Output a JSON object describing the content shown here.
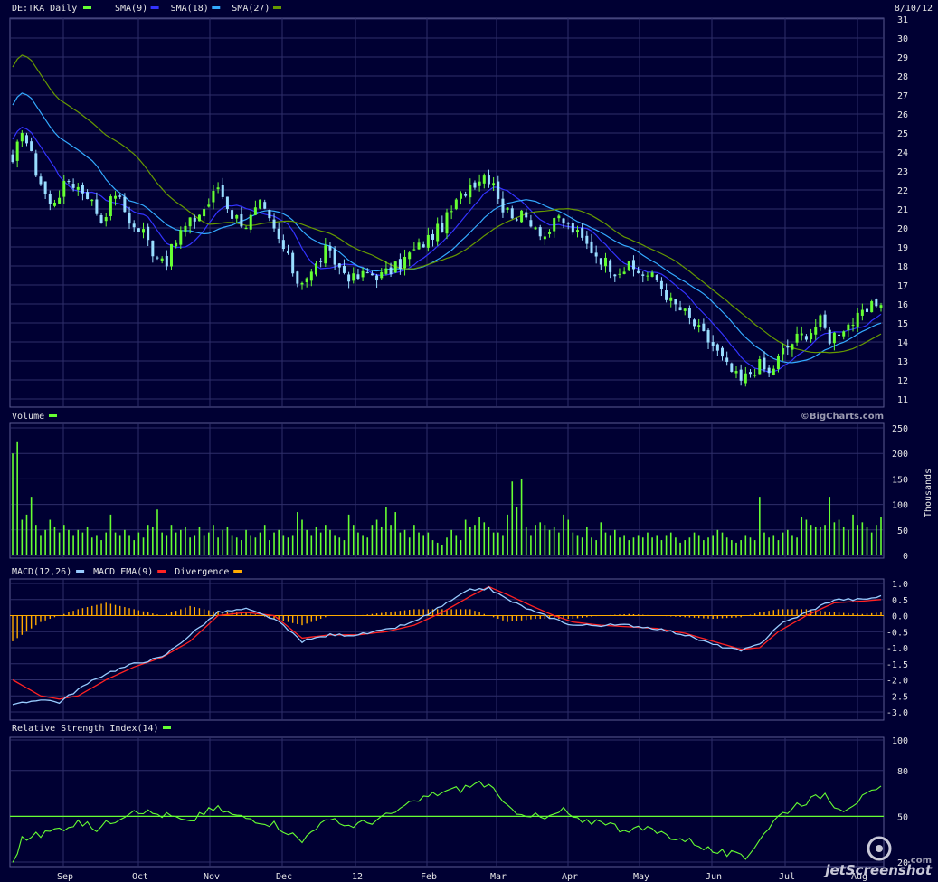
{
  "header": {
    "ticker_label": "DE:TKA Daily",
    "date": "8/10/12"
  },
  "legend_main": [
    {
      "label": "SMA(9)",
      "color": "#3333ff"
    },
    {
      "label": "SMA(18)",
      "color": "#33aaff"
    },
    {
      "label": "SMA(27)",
      "color": "#669900"
    }
  ],
  "ticker_color": "#66ff33",
  "volume_label": "Volume",
  "volume_unit": "Thousands",
  "watermark": "©BigCharts.com",
  "macd_legend": [
    {
      "label": "MACD(12,26)",
      "color": "#99ccff"
    },
    {
      "label": "MACD EMA(9)",
      "color": "#ff2222"
    },
    {
      "label": "Divergence",
      "color": "#ffaa00"
    }
  ],
  "rsi_label": "Relative Strength Index(14)",
  "rsi_color": "#66ff33",
  "logo_text": "jetScreenshot",
  "logo_sub": ".com",
  "x_months": [
    "Sep",
    "Oct",
    "Nov",
    "Dec",
    "12",
    "Feb",
    "Mar",
    "Apr",
    "May",
    "Jun",
    "Jul",
    "Aug"
  ],
  "chart_data": [
    {
      "type": "candlestick",
      "title": "DE:TKA Daily",
      "y_ticks": [
        "31",
        "30",
        "29",
        "28",
        "27",
        "26",
        "25",
        "24",
        "23",
        "22",
        "21",
        "20",
        "19",
        "18",
        "17",
        "16",
        "15",
        "14",
        "13",
        "12",
        "11"
      ],
      "ylim": [
        11,
        31
      ],
      "price_path": [
        [
          0,
          23.2
        ],
        [
          2,
          25.3
        ],
        [
          5,
          23
        ],
        [
          8,
          21.2
        ],
        [
          12,
          22.5
        ],
        [
          16,
          21.8
        ],
        [
          19,
          20.4
        ],
        [
          22,
          21.9
        ],
        [
          24,
          20.9
        ],
        [
          26,
          20
        ],
        [
          28,
          19.8
        ],
        [
          30,
          18.8
        ],
        [
          33,
          18.3
        ],
        [
          36,
          19.8
        ],
        [
          39,
          20.5
        ],
        [
          42,
          21.3
        ],
        [
          44,
          22.2
        ],
        [
          47,
          20.7
        ],
        [
          50,
          20.2
        ],
        [
          53,
          21.2
        ],
        [
          55,
          20.3
        ],
        [
          58,
          18.9
        ],
        [
          61,
          17.2
        ],
        [
          64,
          17.6
        ],
        [
          67,
          18.8
        ],
        [
          70,
          17.9
        ],
        [
          73,
          17.3
        ],
        [
          76,
          17.6
        ],
        [
          79,
          17.5
        ],
        [
          82,
          17.9
        ],
        [
          85,
          18.6
        ],
        [
          88,
          19.2
        ],
        [
          92,
          20.1
        ],
        [
          95,
          21.3
        ],
        [
          98,
          22.3
        ],
        [
          101,
          22.8
        ],
        [
          103,
          22.5
        ],
        [
          105,
          21
        ],
        [
          108,
          20.7
        ],
        [
          111,
          20.4
        ],
        [
          114,
          19.6
        ],
        [
          117,
          20.5
        ],
        [
          120,
          19.9
        ],
        [
          123,
          19.1
        ],
        [
          126,
          18.4
        ],
        [
          129,
          17.8
        ],
        [
          132,
          17.9
        ],
        [
          135,
          17.6
        ],
        [
          138,
          17.3
        ],
        [
          141,
          16.1
        ],
        [
          144,
          15.5
        ],
        [
          147,
          14.6
        ],
        [
          150,
          13.8
        ],
        [
          153,
          12.7
        ],
        [
          156,
          11.9
        ],
        [
          158,
          12.4
        ],
        [
          160,
          12.8
        ],
        [
          162,
          12.3
        ],
        [
          165,
          13.5
        ],
        [
          168,
          14.2
        ],
        [
          171,
          14.6
        ],
        [
          173,
          15.1
        ],
        [
          175,
          14.2
        ],
        [
          178,
          14.8
        ],
        [
          181,
          15.2
        ],
        [
          184,
          15.8
        ],
        [
          186,
          16.2
        ]
      ],
      "sessions": 187
    },
    {
      "type": "bar",
      "title": "Volume",
      "ylabel": "Thousands",
      "y_ticks": [
        "250",
        "200",
        "150",
        "100",
        "50",
        "0"
      ],
      "ylim": [
        0,
        250
      ],
      "values": [
        200,
        222,
        70,
        80,
        115,
        60,
        40,
        50,
        70,
        55,
        45,
        60,
        50,
        40,
        50,
        45,
        55,
        35,
        40,
        30,
        45,
        80,
        45,
        40,
        50,
        40,
        30,
        45,
        35,
        60,
        55,
        90,
        45,
        40,
        60,
        45,
        50,
        55,
        35,
        40,
        55,
        40,
        45,
        60,
        35,
        50,
        55,
        40,
        35,
        30,
        50,
        40,
        35,
        45,
        60,
        30,
        45,
        50,
        40,
        35,
        40,
        85,
        70,
        50,
        40,
        55,
        45,
        60,
        50,
        40,
        35,
        30,
        80,
        60,
        45,
        40,
        35,
        60,
        70,
        55,
        95,
        60,
        85,
        45,
        50,
        35,
        60,
        45,
        40,
        45,
        30,
        25,
        20,
        35,
        50,
        40,
        30,
        70,
        55,
        60,
        75,
        65,
        55,
        45,
        45,
        40,
        80,
        145,
        95,
        150,
        55,
        40,
        60,
        65,
        60,
        50,
        55,
        45,
        80,
        70,
        45,
        40,
        35,
        55,
        35,
        30,
        65,
        45,
        40,
        50,
        35,
        40,
        30,
        35,
        40,
        35,
        45,
        35,
        40,
        30,
        40,
        45,
        35,
        25,
        30,
        35,
        45,
        40,
        30,
        35,
        40,
        50,
        45,
        35,
        30,
        25,
        30,
        40,
        35,
        30,
        115,
        45,
        35,
        40,
        30,
        45,
        50,
        40,
        35,
        75,
        70,
        60,
        55,
        55,
        60,
        115,
        65,
        70,
        55,
        50,
        80,
        60,
        65,
        55,
        45,
        60,
        75,
        50,
        40,
        110,
        40,
        35,
        45,
        60
      ]
    },
    {
      "type": "line",
      "title": "MACD(12,26)",
      "y_ticks": [
        "1.0",
        "0.5",
        "0.0",
        "-0.5",
        "-1.0",
        "-1.5",
        "-2.0",
        "-2.5",
        "-3.0"
      ],
      "ylim": [
        -3.0,
        1.0
      ],
      "series": [
        {
          "name": "MACD(12,26)",
          "path": [
            [
              0,
              -2.8
            ],
            [
              6,
              -2.6
            ],
            [
              10,
              -2.7
            ],
            [
              14,
              -2.3
            ],
            [
              20,
              -1.8
            ],
            [
              26,
              -1.5
            ],
            [
              32,
              -1.3
            ],
            [
              38,
              -0.6
            ],
            [
              44,
              0.1
            ],
            [
              50,
              0.2
            ],
            [
              56,
              -0.1
            ],
            [
              62,
              -0.8
            ],
            [
              68,
              -0.6
            ],
            [
              74,
              -0.6
            ],
            [
              80,
              -0.45
            ],
            [
              86,
              -0.2
            ],
            [
              92,
              0.3
            ],
            [
              98,
              0.8
            ],
            [
              102,
              0.85
            ],
            [
              106,
              0.5
            ],
            [
              112,
              0.1
            ],
            [
              116,
              -0.1
            ],
            [
              120,
              -0.3
            ],
            [
              126,
              -0.3
            ],
            [
              132,
              -0.3
            ],
            [
              138,
              -0.4
            ],
            [
              144,
              -0.6
            ],
            [
              150,
              -0.9
            ],
            [
              156,
              -1.1
            ],
            [
              160,
              -0.9
            ],
            [
              164,
              -0.3
            ],
            [
              170,
              0.1
            ],
            [
              176,
              0.5
            ],
            [
              182,
              0.5
            ],
            [
              186,
              0.6
            ]
          ]
        },
        {
          "name": "MACD EMA(9)",
          "path": [
            [
              0,
              -2.0
            ],
            [
              6,
              -2.5
            ],
            [
              10,
              -2.6
            ],
            [
              14,
              -2.5
            ],
            [
              20,
              -2.0
            ],
            [
              26,
              -1.6
            ],
            [
              32,
              -1.3
            ],
            [
              38,
              -0.8
            ],
            [
              44,
              0.0
            ],
            [
              50,
              0.1
            ],
            [
              56,
              0.0
            ],
            [
              62,
              -0.7
            ],
            [
              68,
              -0.6
            ],
            [
              74,
              -0.6
            ],
            [
              80,
              -0.5
            ],
            [
              86,
              -0.3
            ],
            [
              92,
              0.1
            ],
            [
              98,
              0.6
            ],
            [
              102,
              0.9
            ],
            [
              106,
              0.65
            ],
            [
              112,
              0.25
            ],
            [
              116,
              0.0
            ],
            [
              120,
              -0.2
            ],
            [
              126,
              -0.3
            ],
            [
              132,
              -0.35
            ],
            [
              138,
              -0.4
            ],
            [
              144,
              -0.55
            ],
            [
              150,
              -0.8
            ],
            [
              156,
              -1.05
            ],
            [
              160,
              -1.0
            ],
            [
              164,
              -0.5
            ],
            [
              170,
              0.0
            ],
            [
              176,
              0.4
            ],
            [
              182,
              0.45
            ],
            [
              186,
              0.5
            ]
          ]
        },
        {
          "name": "Divergence",
          "path": [
            [
              0,
              -0.8
            ],
            [
              6,
              -0.2
            ],
            [
              14,
              0.2
            ],
            [
              20,
              0.4
            ],
            [
              26,
              0.2
            ],
            [
              32,
              0.0
            ],
            [
              38,
              0.3
            ],
            [
              44,
              0.1
            ],
            [
              50,
              0.1
            ],
            [
              56,
              -0.1
            ],
            [
              62,
              -0.3
            ],
            [
              68,
              0.0
            ],
            [
              74,
              0.0
            ],
            [
              80,
              0.1
            ],
            [
              86,
              0.2
            ],
            [
              92,
              0.2
            ],
            [
              98,
              0.2
            ],
            [
              102,
              0.0
            ],
            [
              106,
              -0.2
            ],
            [
              112,
              -0.1
            ],
            [
              116,
              -0.1
            ],
            [
              120,
              -0.1
            ],
            [
              126,
              0.0
            ],
            [
              132,
              0.05
            ],
            [
              138,
              0.0
            ],
            [
              144,
              -0.05
            ],
            [
              150,
              -0.1
            ],
            [
              156,
              -0.05
            ],
            [
              160,
              0.1
            ],
            [
              164,
              0.2
            ],
            [
              170,
              0.2
            ],
            [
              176,
              0.1
            ],
            [
              182,
              0.05
            ],
            [
              186,
              0.1
            ]
          ]
        }
      ]
    },
    {
      "type": "line",
      "title": "Relative Strength Index(14)",
      "y_ticks": [
        "100",
        "80",
        "50",
        "20"
      ],
      "ylim": [
        20,
        100
      ],
      "reference_level": 50,
      "series": [
        {
          "name": "Relative Strength Index(14)",
          "path": [
            [
              0,
              20
            ],
            [
              2,
              35
            ],
            [
              6,
              38
            ],
            [
              10,
              42
            ],
            [
              14,
              46
            ],
            [
              18,
              42
            ],
            [
              22,
              48
            ],
            [
              26,
              55
            ],
            [
              30,
              52
            ],
            [
              34,
              50
            ],
            [
              38,
              45
            ],
            [
              40,
              52
            ],
            [
              44,
              55
            ],
            [
              48,
              50
            ],
            [
              52,
              48
            ],
            [
              56,
              45
            ],
            [
              60,
              38
            ],
            [
              62,
              33
            ],
            [
              64,
              42
            ],
            [
              68,
              47
            ],
            [
              72,
              44
            ],
            [
              76,
              46
            ],
            [
              80,
              50
            ],
            [
              84,
              56
            ],
            [
              88,
              62
            ],
            [
              92,
              66
            ],
            [
              96,
              68
            ],
            [
              100,
              72
            ],
            [
              102,
              70
            ],
            [
              106,
              55
            ],
            [
              110,
              52
            ],
            [
              114,
              48
            ],
            [
              118,
              54
            ],
            [
              122,
              45
            ],
            [
              126,
              48
            ],
            [
              130,
              42
            ],
            [
              134,
              42
            ],
            [
              138,
              40
            ],
            [
              142,
              36
            ],
            [
              146,
              33
            ],
            [
              150,
              27
            ],
            [
              154,
              25
            ],
            [
              157,
              22
            ],
            [
              160,
              36
            ],
            [
              164,
              50
            ],
            [
              168,
              58
            ],
            [
              172,
              62
            ],
            [
              174,
              65
            ],
            [
              176,
              58
            ],
            [
              178,
              55
            ],
            [
              182,
              62
            ],
            [
              186,
              68
            ]
          ]
        }
      ]
    }
  ]
}
